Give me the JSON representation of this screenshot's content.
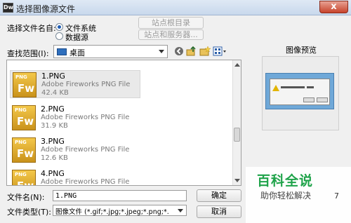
{
  "window": {
    "app_icon_text": "Dw",
    "title": "选择图像源文件",
    "close_label": "x"
  },
  "select_from": {
    "label": "选择文件名自:",
    "options": [
      {
        "label": "文件系统",
        "selected": true
      },
      {
        "label": "数据源",
        "selected": false
      }
    ],
    "site_root_button": "站点根目录",
    "sites_servers_button": "站点和服务器..."
  },
  "lookin": {
    "label": "查找范围(I):",
    "value": "桌面"
  },
  "files": [
    {
      "name": "1.PNG",
      "type": "Adobe Fireworks PNG File",
      "size": "42.4 KB",
      "selected": true,
      "icon_top": "PNG",
      "icon_mid": "Fw"
    },
    {
      "name": "2.PNG",
      "type": "Adobe Fireworks PNG File",
      "size": "31.9 KB",
      "selected": false,
      "icon_top": "PNG",
      "icon_mid": "Fw"
    },
    {
      "name": "3.PNG",
      "type": "Adobe Fireworks PNG File",
      "size": "12.6 KB",
      "selected": false,
      "icon_top": "PNG",
      "icon_mid": "Fw"
    },
    {
      "name": "4.PNG",
      "type": "Adobe Fireworks PNG File",
      "size": "",
      "selected": false,
      "icon_top": "PNG",
      "icon_mid": "Fw"
    }
  ],
  "filename": {
    "label": "文件名(N):",
    "value": "1.PNG"
  },
  "filetype": {
    "label": "文件类型(T):",
    "value": "图像文件 (*.gif;*.jpg;*.jpeg;*.png;*."
  },
  "buttons": {
    "ok": "确定",
    "cancel": "取消"
  },
  "preview": {
    "title": "图像预览"
  },
  "watermark": {
    "big": "百科全说",
    "small": "助你轻松解决",
    "number": "7"
  },
  "icons": [
    "back-icon",
    "up-folder-icon",
    "new-folder-icon",
    "view-menu-icon",
    "desktop-icon",
    "fireworks-file-icon"
  ]
}
